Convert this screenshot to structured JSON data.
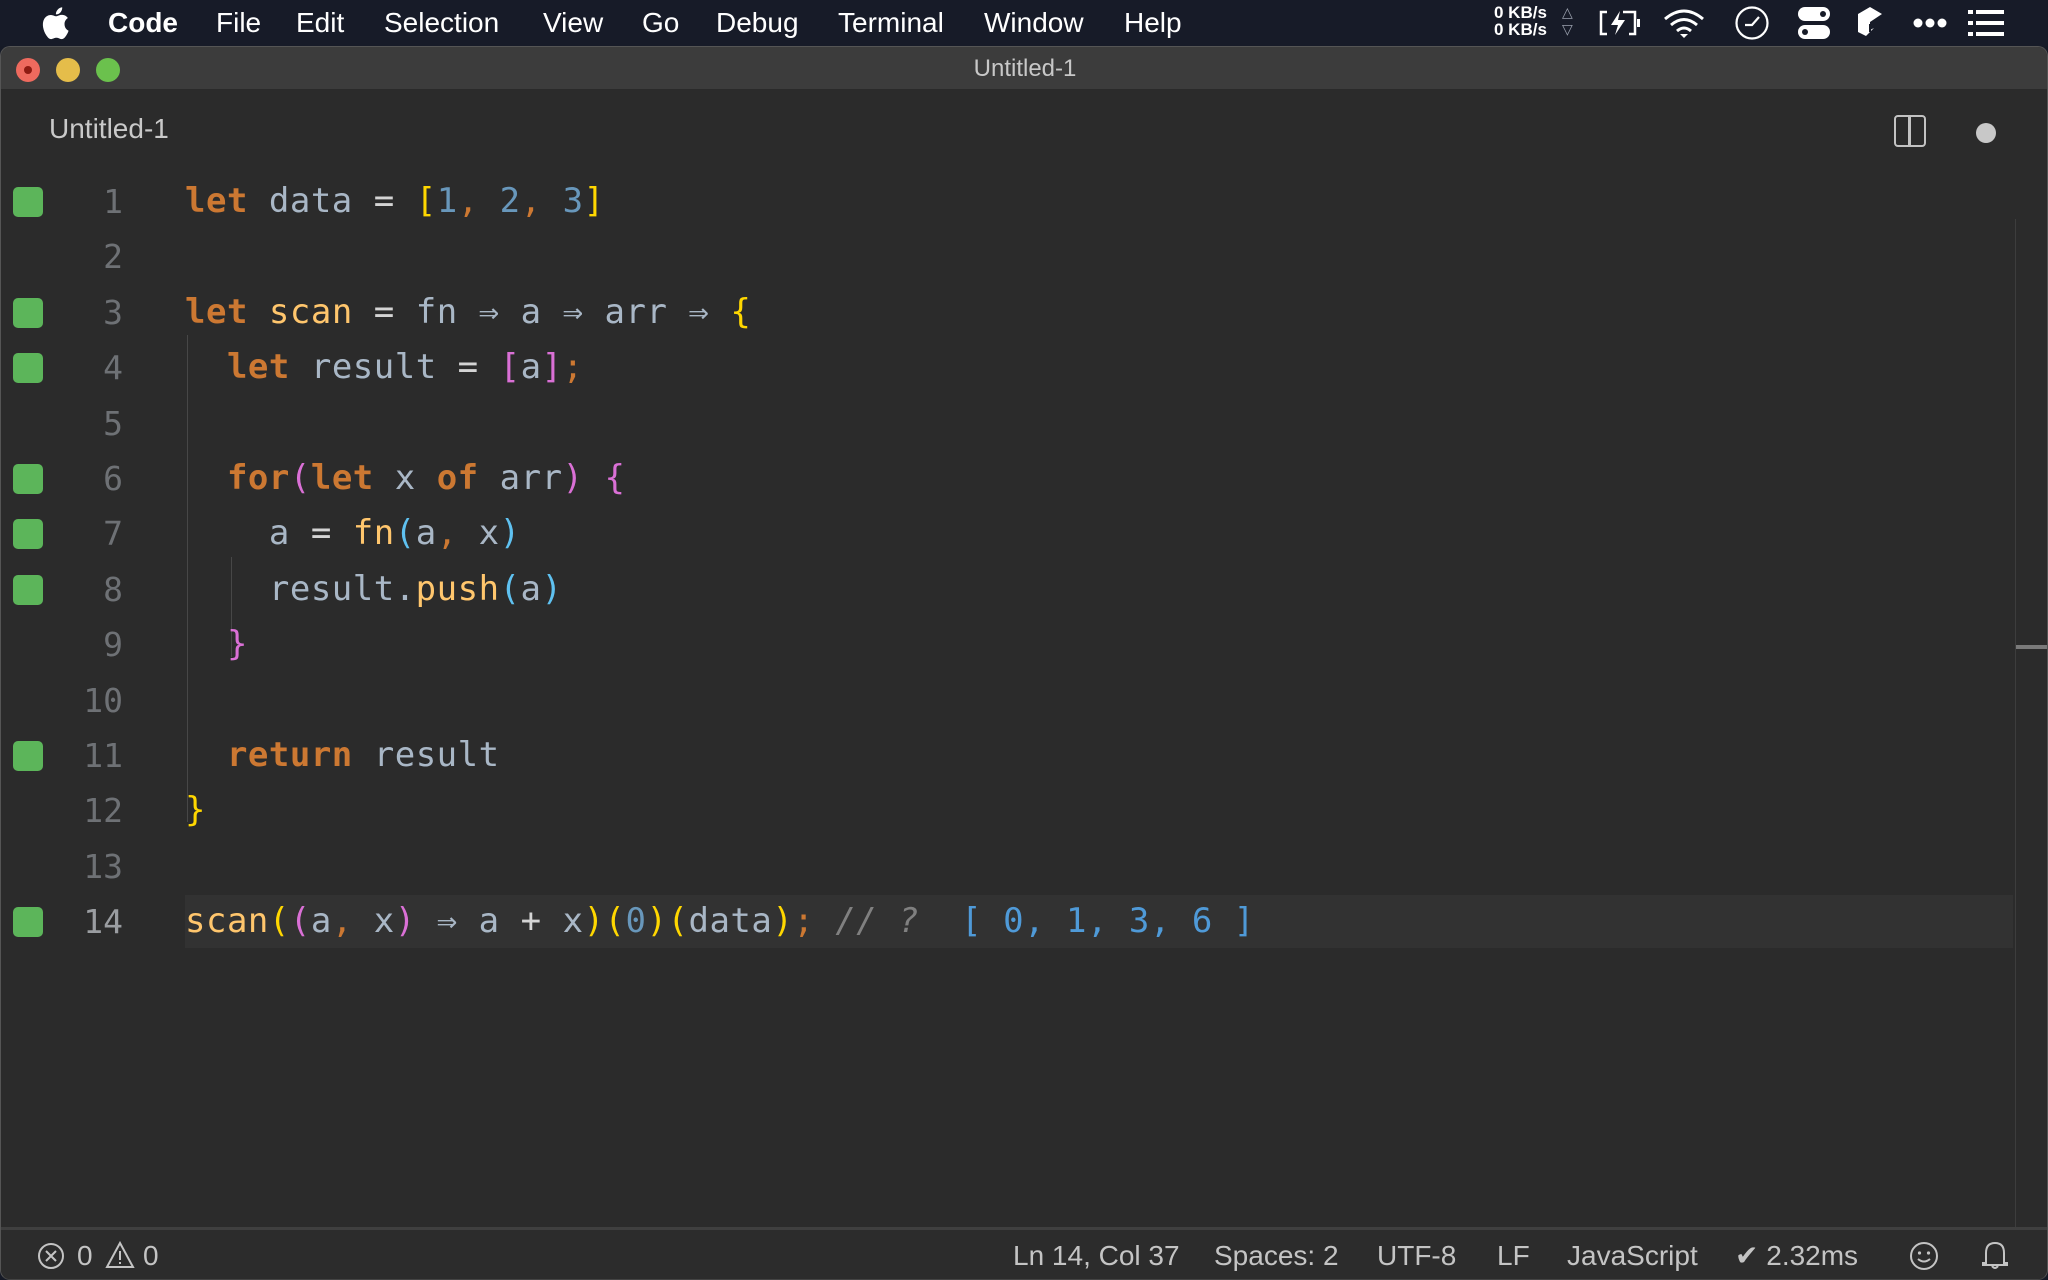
{
  "menubar": {
    "apple_icon": "apple-logo-icon",
    "app_name": "Code",
    "items": [
      "File",
      "Edit",
      "Selection",
      "View",
      "Go",
      "Debug",
      "Terminal",
      "Window",
      "Help"
    ],
    "network": {
      "upload": "0 KB/s",
      "download": "0 KB/s"
    },
    "tray_icons": [
      "battery-charging-icon",
      "wifi-icon",
      "clock-icon",
      "control-center-toggles-icon",
      "app-cube-icon",
      "more-dots-icon",
      "list-menu-icon"
    ]
  },
  "window": {
    "title": "Untitled-1",
    "controls": [
      "close",
      "minimize",
      "maximize"
    ]
  },
  "tab": {
    "title": "Untitled-1",
    "split_editor_icon": "split-editor-icon",
    "unsaved_indicator_icon": "unsaved-dot-icon"
  },
  "editor": {
    "language": "JavaScript",
    "current_line": 14,
    "lines": [
      {
        "number": "1",
        "covered": true,
        "tokens": [
          [
            "kw",
            "let"
          ],
          [
            "id",
            " data "
          ],
          [
            "op",
            "="
          ],
          [
            "id",
            " "
          ],
          [
            "br1",
            "["
          ],
          [
            "num",
            "1"
          ],
          [
            "punc",
            ","
          ],
          [
            "id",
            " "
          ],
          [
            "num",
            "2"
          ],
          [
            "punc",
            ","
          ],
          [
            "id",
            " "
          ],
          [
            "num",
            "3"
          ],
          [
            "br1",
            "]"
          ]
        ]
      },
      {
        "number": "2",
        "covered": false,
        "tokens": []
      },
      {
        "number": "3",
        "covered": true,
        "tokens": [
          [
            "kw",
            "let"
          ],
          [
            "id",
            " "
          ],
          [
            "fnname",
            "scan"
          ],
          [
            "id",
            " "
          ],
          [
            "op",
            "="
          ],
          [
            "id",
            " fn "
          ],
          [
            "id",
            "⇒"
          ],
          [
            "id",
            " a "
          ],
          [
            "id",
            "⇒"
          ],
          [
            "id",
            " arr "
          ],
          [
            "id",
            "⇒"
          ],
          [
            "id",
            " "
          ],
          [
            "br1",
            "{"
          ]
        ]
      },
      {
        "number": "4",
        "covered": true,
        "tokens": [
          [
            "id",
            "  "
          ],
          [
            "kw",
            "let"
          ],
          [
            "id",
            " result "
          ],
          [
            "op",
            "="
          ],
          [
            "id",
            " "
          ],
          [
            "br2",
            "["
          ],
          [
            "id",
            "a"
          ],
          [
            "br2",
            "]"
          ],
          [
            "punc",
            ";"
          ]
        ]
      },
      {
        "number": "5",
        "covered": false,
        "tokens": []
      },
      {
        "number": "6",
        "covered": true,
        "tokens": [
          [
            "id",
            "  "
          ],
          [
            "kw",
            "for"
          ],
          [
            "br2",
            "("
          ],
          [
            "kw",
            "let"
          ],
          [
            "id",
            " x "
          ],
          [
            "kw",
            "of"
          ],
          [
            "id",
            " arr"
          ],
          [
            "br2",
            ")"
          ],
          [
            "id",
            " "
          ],
          [
            "br2",
            "{"
          ]
        ]
      },
      {
        "number": "7",
        "covered": true,
        "tokens": [
          [
            "id",
            "    a "
          ],
          [
            "op",
            "="
          ],
          [
            "id",
            " "
          ],
          [
            "fnname",
            "fn"
          ],
          [
            "br3",
            "("
          ],
          [
            "id",
            "a"
          ],
          [
            "punc",
            ","
          ],
          [
            "id",
            " x"
          ],
          [
            "br3",
            ")"
          ]
        ]
      },
      {
        "number": "8",
        "covered": true,
        "tokens": [
          [
            "id",
            "    result."
          ],
          [
            "fnname",
            "push"
          ],
          [
            "br3",
            "("
          ],
          [
            "id",
            "a"
          ],
          [
            "br3",
            ")"
          ]
        ]
      },
      {
        "number": "9",
        "covered": false,
        "tokens": [
          [
            "id",
            "  "
          ],
          [
            "br2",
            "}"
          ]
        ]
      },
      {
        "number": "10",
        "covered": false,
        "tokens": []
      },
      {
        "number": "11",
        "covered": true,
        "tokens": [
          [
            "id",
            "  "
          ],
          [
            "kw",
            "return"
          ],
          [
            "id",
            " result"
          ]
        ]
      },
      {
        "number": "12",
        "covered": false,
        "tokens": [
          [
            "br1",
            "}"
          ]
        ]
      },
      {
        "number": "13",
        "covered": false,
        "tokens": []
      },
      {
        "number": "14",
        "covered": true,
        "tokens": [
          [
            "fnname",
            "scan"
          ],
          [
            "br1",
            "("
          ],
          [
            "br2",
            "("
          ],
          [
            "id",
            "a"
          ],
          [
            "punc",
            ","
          ],
          [
            "id",
            " x"
          ],
          [
            "br2",
            ")"
          ],
          [
            "id",
            " ⇒ a "
          ],
          [
            "op",
            "+"
          ],
          [
            "id",
            " x"
          ],
          [
            "br1",
            ")"
          ],
          [
            "br1",
            "("
          ],
          [
            "num",
            "0"
          ],
          [
            "br1",
            ")"
          ],
          [
            "br1",
            "("
          ],
          [
            "id",
            "data"
          ],
          [
            "br1",
            ")"
          ],
          [
            "punc",
            ";"
          ],
          [
            "id",
            " "
          ],
          [
            "cmt",
            "// ?"
          ],
          [
            "id",
            "  "
          ],
          [
            "result",
            "[ 0, 1, 3, 6 ]"
          ]
        ]
      }
    ]
  },
  "statusbar": {
    "errors": "0",
    "warnings": "0",
    "cursor": "Ln 14, Col 37",
    "indent": "Spaces: 2",
    "encoding": "UTF-8",
    "eol": "LF",
    "language": "JavaScript",
    "timing": "✔ 2.32ms",
    "feedback_icon": "smiley-icon",
    "notifications_icon": "bell-icon"
  },
  "colors": {
    "keyword": "#cc7832",
    "identifier": "#a9b7c6",
    "function": "#ffc66d",
    "number": "#6897bb",
    "bracket_gold": "#ffd700",
    "bracket_orchid": "#da70d6",
    "bracket_blue": "#5fc1f0",
    "comment": "#808080",
    "inline_result": "#4f9ad8",
    "coverage_marker": "#5cb55a",
    "editor_bg": "#2b2b2b"
  }
}
